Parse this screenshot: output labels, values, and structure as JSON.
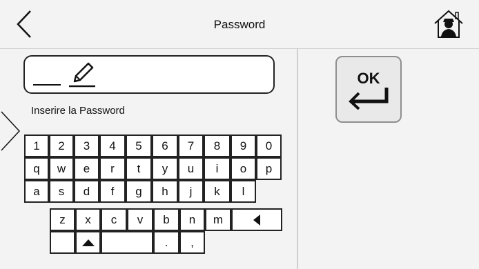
{
  "header": {
    "title": "Password",
    "back_icon": "chevron-left-icon",
    "home_icon": "home-user-icon"
  },
  "password_field": {
    "value": "",
    "edit_icon": "pencil-icon"
  },
  "prompt": "Inserire la Password",
  "keyboard": {
    "row1": [
      "1",
      "2",
      "3",
      "4",
      "5",
      "6",
      "7",
      "8",
      "9",
      "0"
    ],
    "row2": [
      "q",
      "w",
      "e",
      "r",
      "t",
      "y",
      "u",
      "i",
      "o",
      "p"
    ],
    "row3": [
      "a",
      "s",
      "d",
      "f",
      "g",
      "h",
      "j",
      "k",
      "l"
    ],
    "row4": [
      "z",
      "x",
      "c",
      "v",
      "b",
      "n",
      "m"
    ],
    "row5": [
      ".",
      ","
    ],
    "backspace_icon": "triangle-left-icon",
    "shift_icon": "triangle-up-icon"
  },
  "ok_button": {
    "label": "OK",
    "icon": "enter-arrow-icon"
  }
}
